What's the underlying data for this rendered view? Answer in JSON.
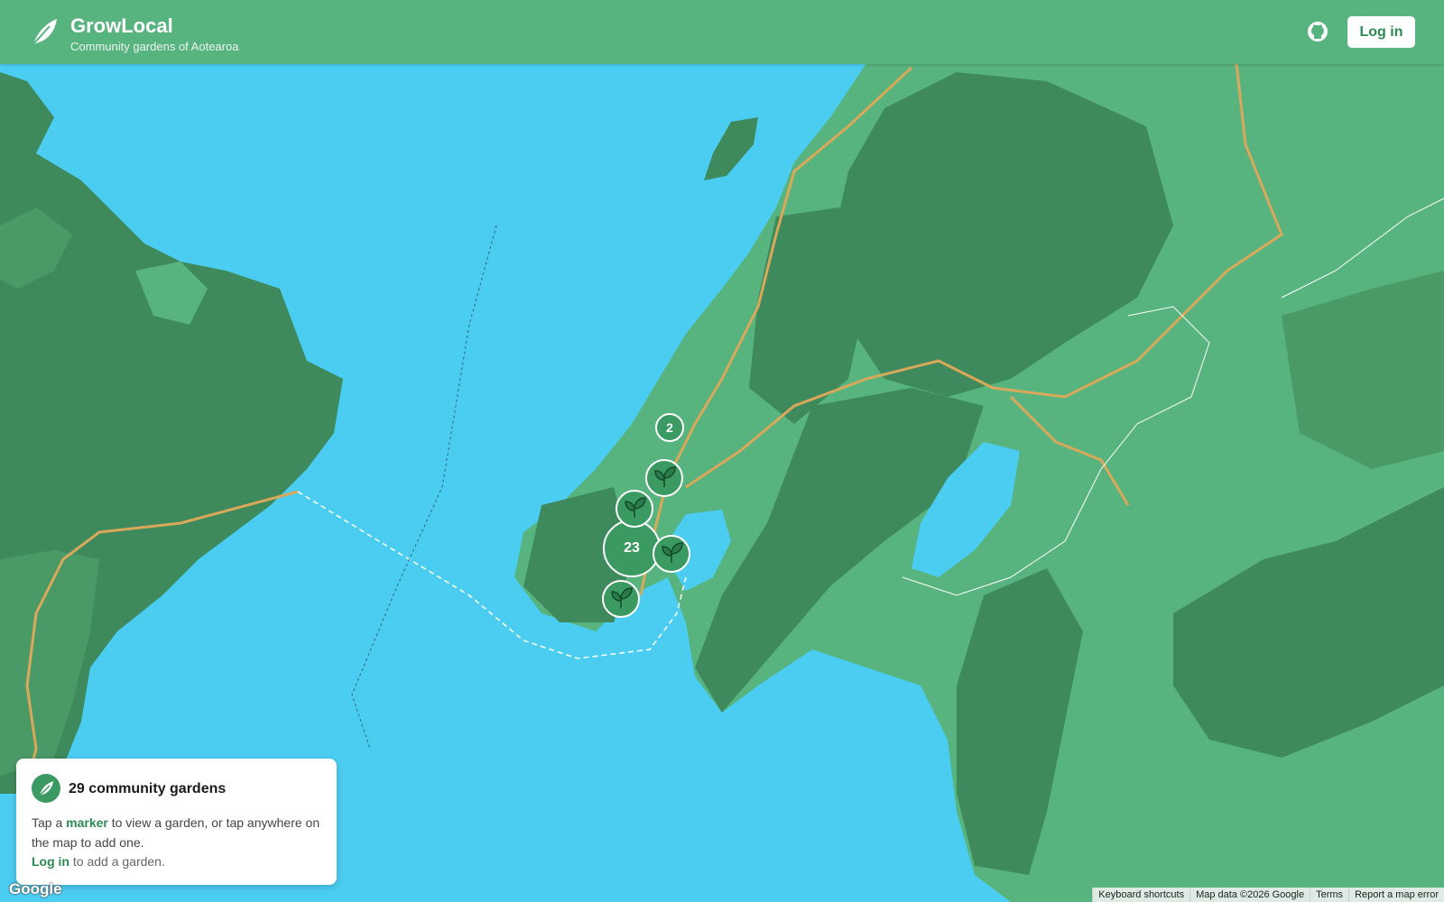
{
  "header": {
    "app_title": "GrowLocal",
    "app_subtitle": "Community gardens of Aotearoa",
    "github_icon": "github-icon",
    "login_label": "Log in"
  },
  "map": {
    "clusters": [
      {
        "count": "2"
      },
      {
        "count": "23"
      }
    ],
    "garden_marker_icon": "seedling-icon",
    "colors": {
      "water": "#4bcdf2",
      "land": "#58b47e",
      "forest": "#3f8a5c",
      "road": "#d9a85a"
    }
  },
  "panel": {
    "title": "29 community gardens",
    "text_prefix": "Tap a",
    "text_link": "marker",
    "text_suffix": "to view a garden, or tap anywhere on the map to add one.",
    "login_link": "Log in",
    "login_suffix": "to add a garden."
  },
  "attribution": {
    "logo": "Google",
    "keyboard": "Keyboard shortcuts",
    "mapdata": "Map data ©2026 Google",
    "terms": "Terms",
    "report": "Report a map error"
  }
}
